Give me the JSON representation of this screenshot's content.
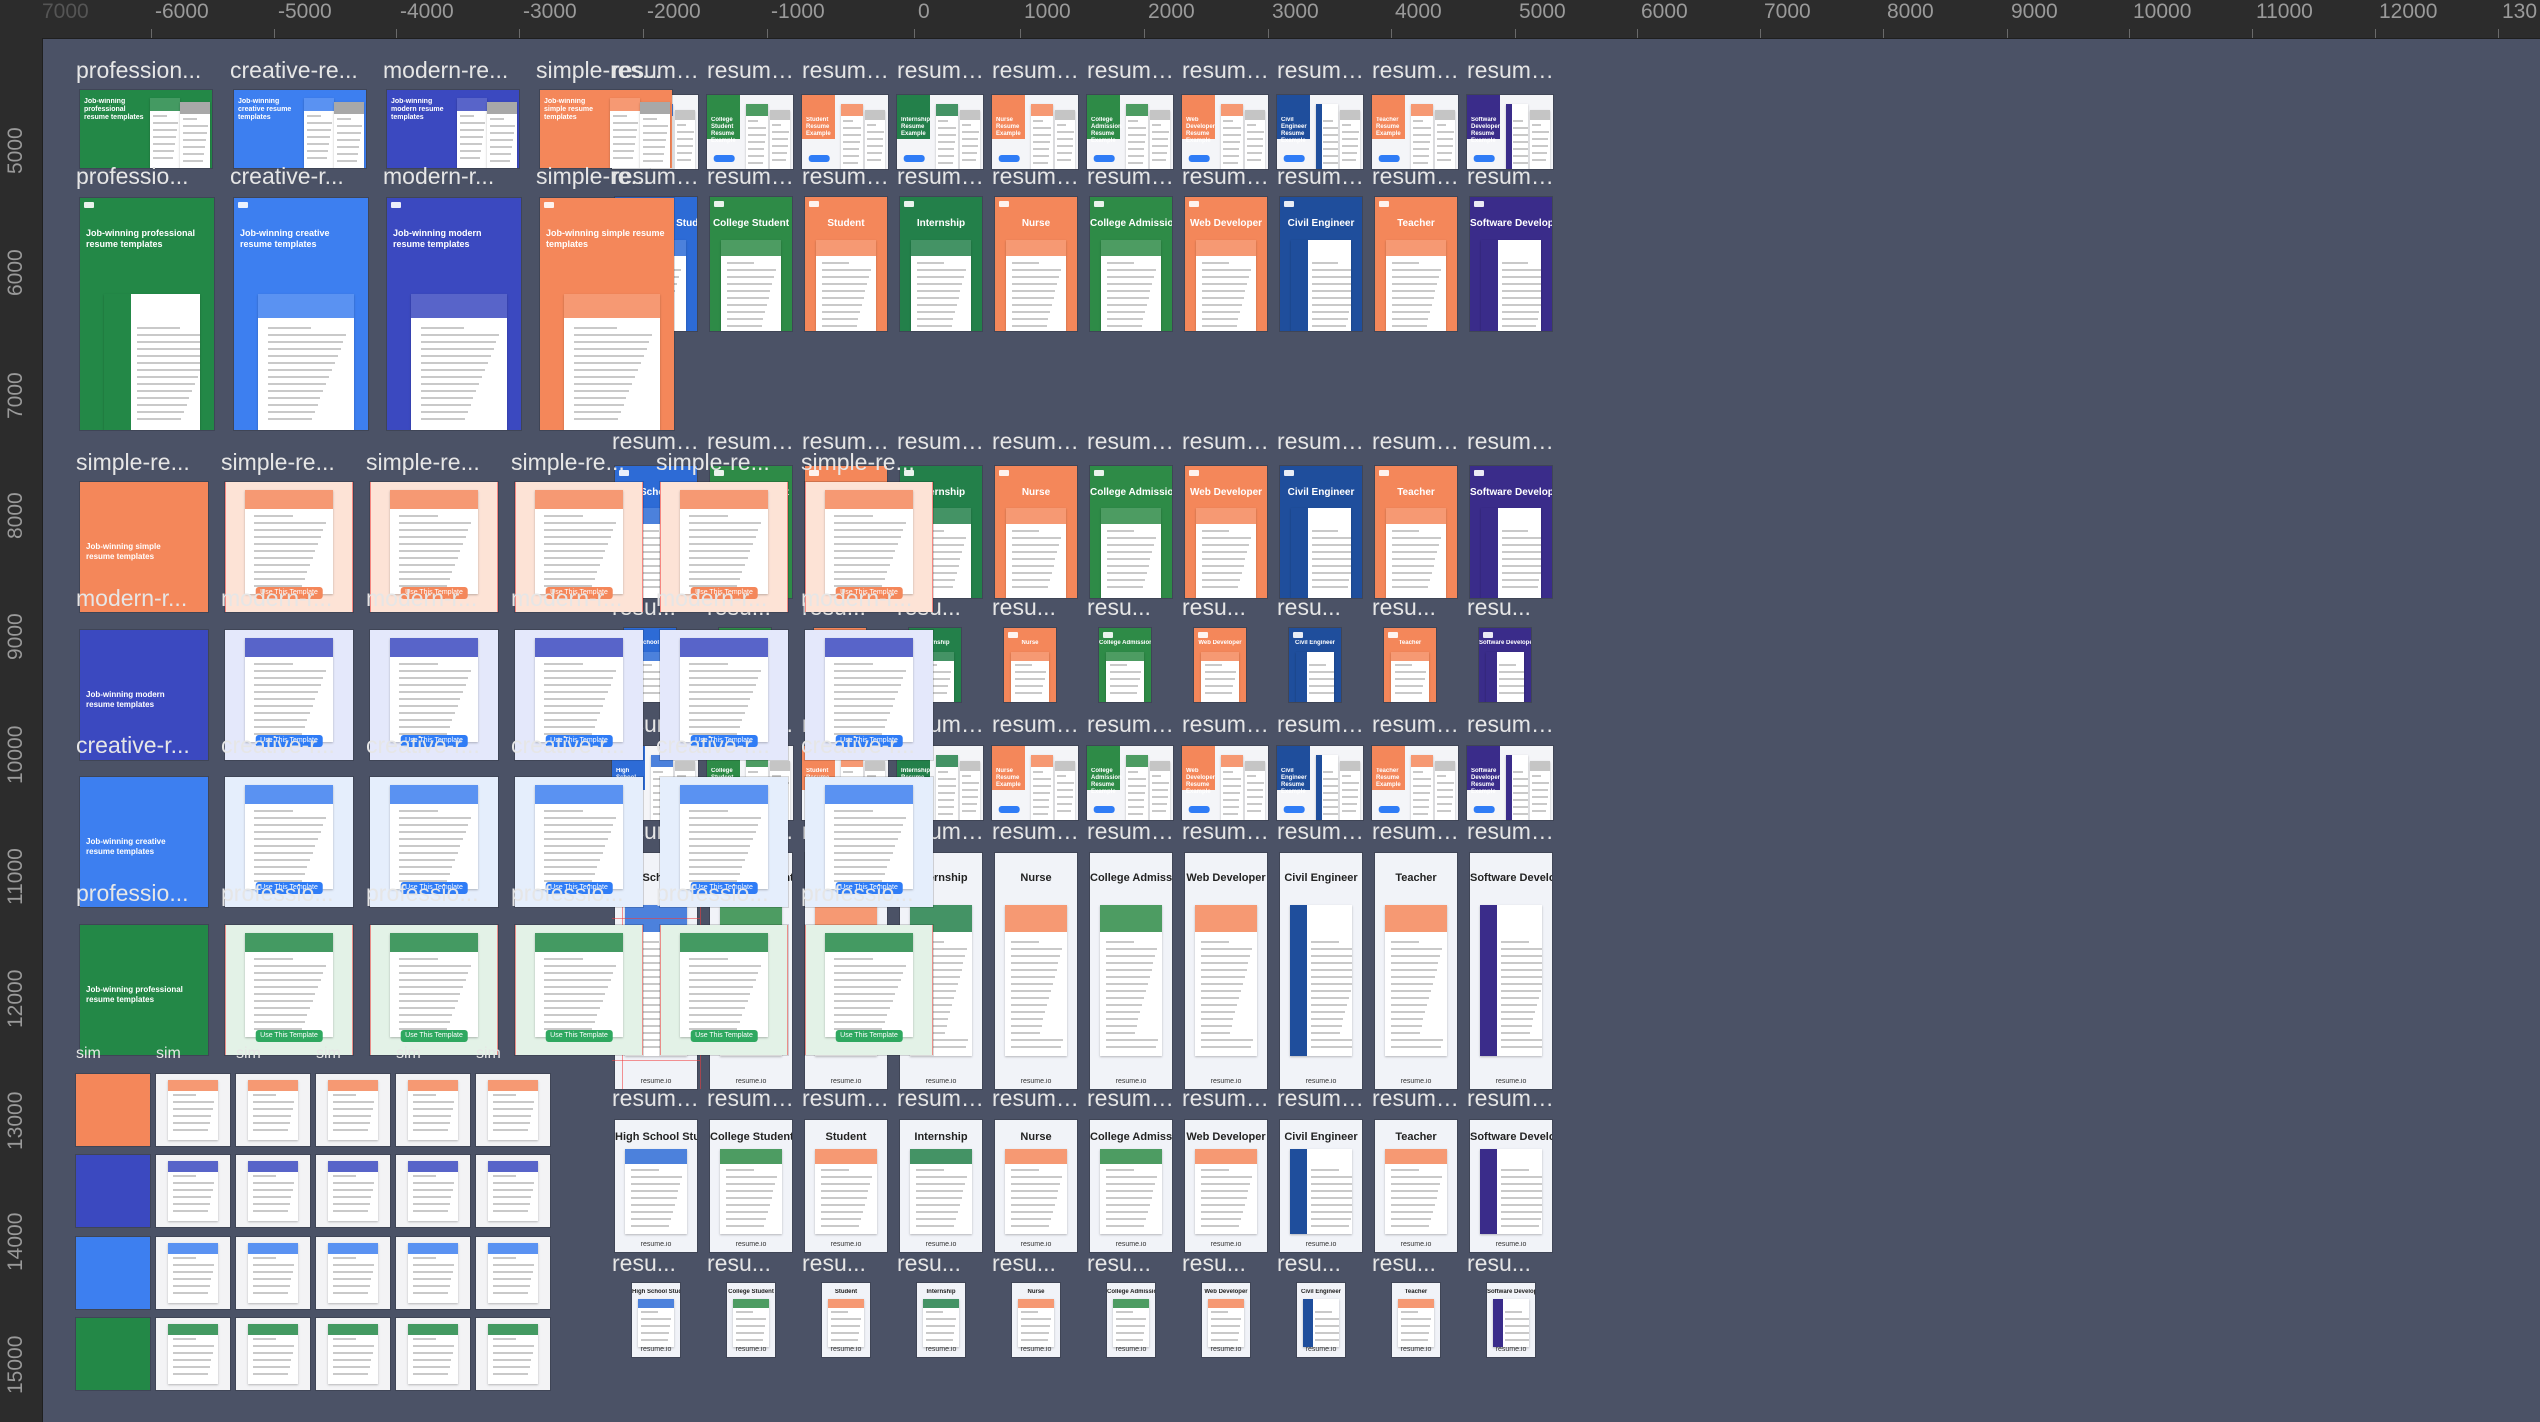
{
  "ruler": {
    "top_ticks": [
      "7000",
      "-6000",
      "-5000",
      "-4000",
      "-3000",
      "-2000",
      "-1000",
      "0",
      "1000",
      "2000",
      "3000",
      "4000",
      "5000",
      "6000",
      "7000",
      "8000",
      "9000",
      "10000",
      "11000",
      "12000",
      "130"
    ],
    "left_ticks": [
      "5000",
      "6000",
      "7000",
      "8000",
      "9000",
      "10000",
      "11000",
      "12000",
      "13000",
      "14000",
      "15000"
    ]
  },
  "left_group": {
    "row1_labels": [
      "profession...",
      "creative-re...",
      "modern-re...",
      "simple-res..."
    ],
    "row2_labels": [
      "professio...",
      "creative-r...",
      "modern-r...",
      "simple-re..."
    ],
    "hero_titles": [
      "Job-winning professional resume templates",
      "Job-winning creative resume templates",
      "Job-winning modern resume templates",
      "Job-winning simple resume templates"
    ],
    "simple_row_labels": [
      "simple-re...",
      "simple-re...",
      "simple-re...",
      "simple-re...",
      "simple-re...",
      "simple-re..."
    ],
    "modern_row_labels": [
      "modern-r...",
      "modern-r...",
      "modern-r...",
      "modern-r...",
      "modern-r...",
      "modern-r..."
    ],
    "creative_row_labels": [
      "creative-r...",
      "creative-r...",
      "creative-r...",
      "creative-r...",
      "creative-r...",
      "creative-r..."
    ],
    "professional_row_labels": [
      "professio...",
      "professio...",
      "professio...",
      "professio...",
      "professio...",
      "professio..."
    ],
    "use_template": "Use This Template",
    "small_labels": [
      "sim",
      "sim",
      "sim",
      "sim",
      "sim",
      "sim"
    ]
  },
  "right_group": {
    "row_labels_long": [
      "resume-ex...",
      "resume-ex...",
      "resume-ex...",
      "resume-ex...",
      "resume-ex...",
      "resume-ex...",
      "resume-ex...",
      "resume-ex...",
      "resume-ex...",
      "resume-ex..."
    ],
    "row_labels_med": [
      "resume-e...",
      "resume-e...",
      "resume-e...",
      "resume-e...",
      "resume-e...",
      "resume-e...",
      "resume-e...",
      "resume-e...",
      "resume-e...",
      "resume-e..."
    ],
    "row_labels_short": [
      "resu...",
      "resu...",
      "resu...",
      "resu...",
      "resu...",
      "resu...",
      "resu...",
      "resu...",
      "resu...",
      "resu..."
    ],
    "examples": [
      "High School Student",
      "College Student",
      "Student",
      "Internship",
      "Nurse",
      "College Admissions",
      "Web Developer",
      "Civil Engineer",
      "Teacher",
      "Software Developer"
    ],
    "example_captions": [
      "High School Student Resume Example",
      "College Student Resume Example",
      "Student Resume Example",
      "Internship Resume Example",
      "Nurse Resume Example",
      "College Admissions Resume Example",
      "Web Developer Resume Example",
      "Civil Engineer Resume Example",
      "Teacher Resume Example",
      "Software Developer Resume Example"
    ],
    "brand": "resume.io"
  },
  "colors": {
    "canvas_bg": "#4b5266",
    "ruler_bg": "#2c2c2c",
    "accents": [
      "#2d6bd6",
      "#2e8b47",
      "#f4875a",
      "#23804a",
      "#f4875a",
      "#2e8b47",
      "#f4875a",
      "#1f4e9c",
      "#f4875a",
      "#3a2c8a"
    ],
    "simple": "#f4875a",
    "modern": "#3b49c0",
    "creative": "#3d7ff0",
    "professional": "#238847"
  }
}
